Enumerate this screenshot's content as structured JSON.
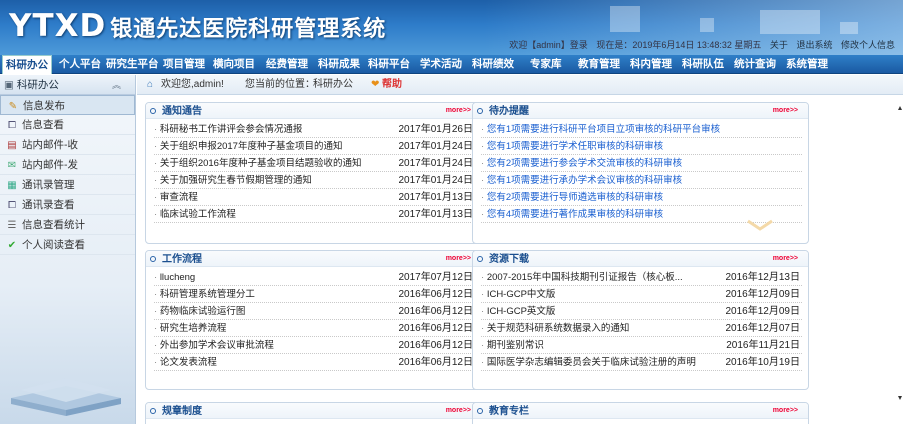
{
  "header": {
    "logo_abbr": "YTXD",
    "logo_title": "银通先达医院科研管理系统",
    "welcome": "欢迎【admin】登录",
    "date": "现在是：2019年6月14日 13:48:32 星期五",
    "about": "关于",
    "logout": "退出系统",
    "personal": "修改个人信息"
  },
  "nav": [
    "科研办公",
    "个人平台",
    "研究生平台",
    "项目管理",
    "横向项目",
    "经费管理",
    "科研成果",
    "科研平台",
    "学术活动",
    "科研绩效",
    "专家库",
    "教育管理",
    "科内管理",
    "科研队伍",
    "统计查询",
    "系统管理"
  ],
  "sidebar": {
    "title": "科研办公",
    "collapse_icon": "double-chevron-up-icon",
    "items": [
      {
        "label": "信息发布",
        "icon": "pencil-icon"
      },
      {
        "label": "信息查看",
        "icon": "book-icon"
      },
      {
        "label": "站内邮件-收",
        "icon": "inbox-icon"
      },
      {
        "label": "站内邮件-发",
        "icon": "send-mail-icon"
      },
      {
        "label": "通讯录管理",
        "icon": "address-book-icon"
      },
      {
        "label": "通讯录查看",
        "icon": "book-icon"
      },
      {
        "label": "信息查看统计",
        "icon": "list-icon"
      },
      {
        "label": "个人阅读查看",
        "icon": "check-icon"
      }
    ]
  },
  "breadcrumb": {
    "home_icon": "home-icon",
    "welcome": "欢迎您,admin!",
    "location_label": "您当前的位置：",
    "location": "科研办公",
    "help": "帮助"
  },
  "panels": {
    "notices": {
      "title": "通知通告",
      "more": "more>>",
      "rows": [
        {
          "text": "科研秘书工作讲评会参会情况通报",
          "date": "2017年01月26日"
        },
        {
          "text": "关于组织申报2017年度种子基金项目的通知",
          "date": "2017年01月24日"
        },
        {
          "text": "关于组织2016年度种子基金项目结题验收的通知",
          "date": "2017年01月24日"
        },
        {
          "text": "关于加强研究生春节假期管理的通知",
          "date": "2017年01月24日"
        },
        {
          "text": "审查流程",
          "date": "2017年01月13日"
        },
        {
          "text": "临床试验工作流程",
          "date": "2017年01月13日"
        }
      ]
    },
    "todo": {
      "title": "待办提醒",
      "more": "more>>",
      "rows": [
        {
          "text": "您有1项需要进行科研平台项目立项审核的科研平台审核"
        },
        {
          "text": "您有1项需要进行学术任职审核的科研审核"
        },
        {
          "text": "您有2项需要进行参会学术交流审核的科研审核"
        },
        {
          "text": "您有1项需要进行承办学术会议审核的科研审核"
        },
        {
          "text": "您有2项需要进行导师遴选审核的科研审核"
        },
        {
          "text": "您有4项需要进行著作成果审核的科研审核"
        }
      ]
    },
    "workflow": {
      "title": "工作流程",
      "more": "more>>",
      "rows": [
        {
          "text": "llucheng",
          "date": "2017年07月12日"
        },
        {
          "text": "科研管理系统管理分工",
          "date": "2016年06月12日"
        },
        {
          "text": "药物临床试验运行图",
          "date": "2016年06月12日"
        },
        {
          "text": "研究生培养流程",
          "date": "2016年06月12日"
        },
        {
          "text": "外出参加学术会议审批流程",
          "date": "2016年06月12日"
        },
        {
          "text": "论文发表流程",
          "date": "2016年06月12日"
        }
      ]
    },
    "downloads": {
      "title": "资源下载",
      "more": "more>>",
      "rows": [
        {
          "text": "2007-2015年中国科技期刊引证报告（核心板...",
          "date": "2016年12月13日"
        },
        {
          "text": "ICH-GCP中文版",
          "date": "2016年12月09日"
        },
        {
          "text": "ICH-GCP英文版",
          "date": "2016年12月09日"
        },
        {
          "text": "关于规范科研系统数据录入的通知",
          "date": "2016年12月07日"
        },
        {
          "text": "期刊鉴别常识",
          "date": "2016年11月21日"
        },
        {
          "text": "国际医学杂志编辑委员会关于临床试验注册的声明",
          "date": "2016年10月19日"
        }
      ]
    },
    "rules": {
      "title": "规章制度",
      "more": "more>>"
    },
    "education": {
      "title": "教育专栏",
      "more": "more>>"
    }
  }
}
